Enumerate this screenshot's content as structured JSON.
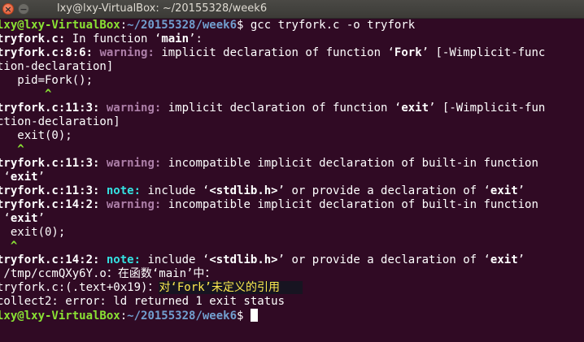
{
  "window": {
    "title": "lxy@lxy-VirtualBox: ~/20155328/week6",
    "close_glyph": "×",
    "minimize_glyph": "−"
  },
  "prompt": {
    "user_host": "lxy@lxy-VirtualBox",
    "sep": ":",
    "path": "~/20155328/week6",
    "dollar": "$ "
  },
  "lines": {
    "l1_cmd": "gcc tryfork.c -o tryfork",
    "l2_file": "tryfork.c:",
    "l2_text": " In function ‘",
    "l2_func": "main",
    "l2_end": "’:",
    "l3_loc": "tryfork.c:8:6:",
    "l3_tag": "warning:",
    "l3_text": " implicit declaration of function ‘",
    "l3_func": "Fork",
    "l3_end": "’ [-Wimplicit-func",
    "l4": "tion-declaration]",
    "l5": "   pid=Fork();",
    "l6": "       ^",
    "l7_loc": "tryfork.c:11:3:",
    "l7_tag": "warning:",
    "l7_text": " implicit declaration of function ‘",
    "l7_func": "exit",
    "l7_end": "’ [-Wimplicit-fun",
    "l8": "ction-declaration]",
    "l9": "   exit(0);",
    "l10": "   ^",
    "l11_loc": "tryfork.c:11:3:",
    "l11_tag": "warning:",
    "l11_text": " incompatible implicit declaration of built-in function",
    "l12_open": " ‘",
    "l12_func": "exit",
    "l12_close": "’",
    "l13_loc": "tryfork.c:11:3:",
    "l13_tag": "note:",
    "l13_text1": " include ‘",
    "l13_hdr": "<stdlib.h>",
    "l13_text2": "’ or provide a declaration of ‘",
    "l13_func": "exit",
    "l13_end": "’",
    "l14_loc": "tryfork.c:14:2:",
    "l14_tag": "warning:",
    "l14_text": " incompatible implicit declaration of built-in function",
    "l15_open": " ‘",
    "l15_func": "exit",
    "l15_close": "’",
    "l16": "  exit(0);",
    "l17": "  ^",
    "l19_loc": "tryfork.c:14:2:",
    "l19_tag": "note:",
    "l19_text1": " include ‘",
    "l19_hdr": "<stdlib.h>",
    "l19_text2": "’ or provide a declaration of ‘",
    "l19_func": "exit",
    "l19_end": "’",
    "l20": " /tmp/ccmQXy6Y.o：在函数‘main’中：",
    "l21_pre": "tryfork.c:(.text+0x19)：",
    "l21_cn": "对‘Fork’未定义的引用",
    "l22": "collect2: error: ld returned 1 exit status"
  },
  "colors": {
    "background": "#300a24",
    "prompt_user": "#8ae234",
    "prompt_path": "#729fcf",
    "warning": "#ad7fa8",
    "note": "#34e2e2",
    "text": "#ffffff"
  }
}
